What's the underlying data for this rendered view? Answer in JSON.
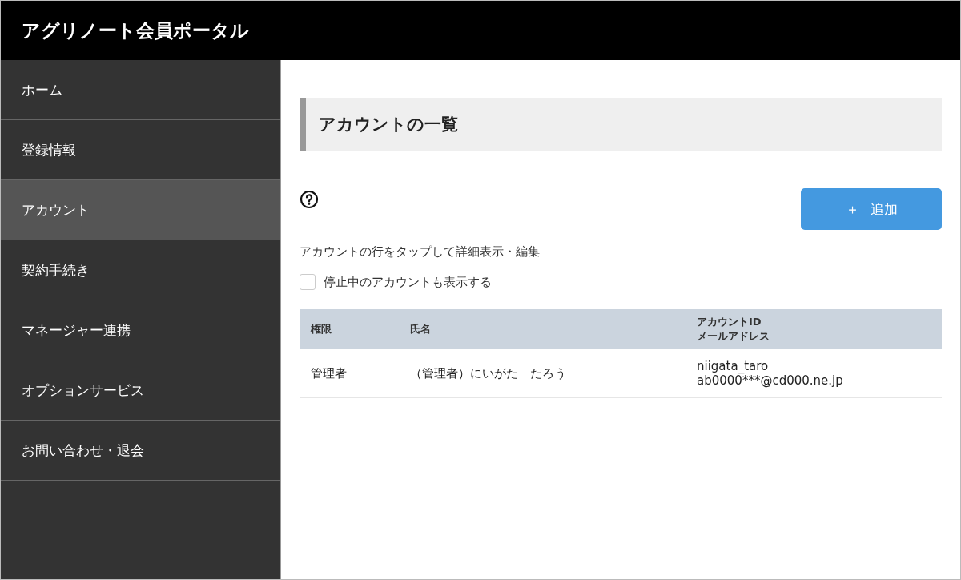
{
  "header": {
    "title": "アグリノート会員ポータル"
  },
  "sidebar": {
    "items": [
      {
        "label": "ホーム",
        "selected": false
      },
      {
        "label": "登録情報",
        "selected": false
      },
      {
        "label": "アカウント",
        "selected": true
      },
      {
        "label": "契約手続き",
        "selected": false
      },
      {
        "label": "マネージャー連携",
        "selected": false
      },
      {
        "label": "オプションサービス",
        "selected": false
      },
      {
        "label": "お問い合わせ・退会",
        "selected": false
      }
    ]
  },
  "page_title": "アカウントの一覧",
  "add_button": {
    "icon": "＋",
    "label": "追加"
  },
  "hint": "アカウントの行をタップして詳細表示・編集",
  "show_suspended": {
    "label": "停止中のアカウントも表示する",
    "checked": false
  },
  "table": {
    "columns": [
      "権限",
      "氏名",
      "アカウントID\nメールアドレス"
    ],
    "rows": [
      {
        "cells": [
          "管理者",
          "（管理者）にいがた　たろう",
          "niigata_taro\nab0000***@cd000.ne.jp"
        ]
      }
    ]
  }
}
